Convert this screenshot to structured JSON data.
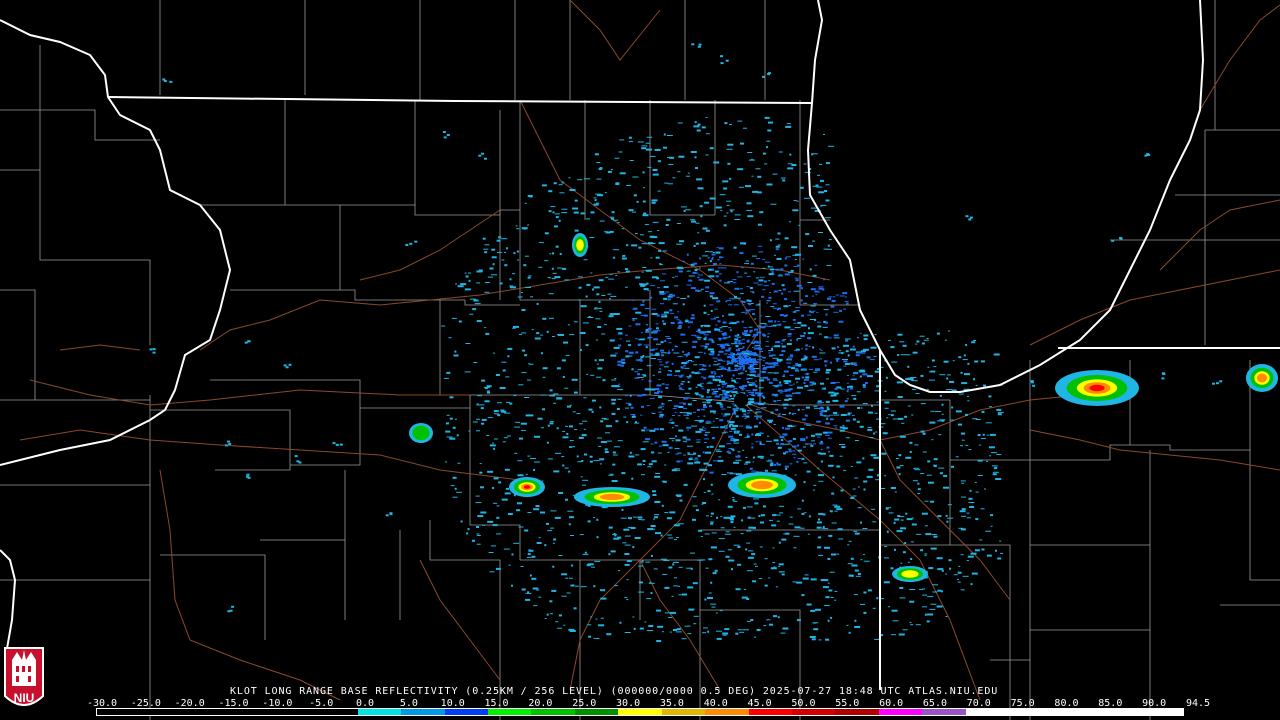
{
  "header": {
    "product_line": "KLOT LONG RANGE BASE REFLECTIVITY (0.25KM / 256 LEVEL) (000000/0000 0.5 DEG) 2025-07-27 18:48 UTC  ATLAS.NIU.EDU"
  },
  "logo": {
    "text": "NIU"
  },
  "legend": {
    "ticks": [
      "-30.0",
      "-25.0",
      "-20.0",
      "-15.0",
      "-10.0",
      "-5.0",
      "0.0",
      "5.0",
      "10.0",
      "15.0",
      "20.0",
      "25.0",
      "30.0",
      "35.0",
      "40.0",
      "45.0",
      "50.0",
      "55.0",
      "60.0",
      "65.0",
      "70.0",
      "75.0",
      "80.0",
      "85.0",
      "90.0",
      "94.5"
    ],
    "colors": [
      "#000000",
      "#000000",
      "#000000",
      "#000000",
      "#000000",
      "#000000",
      "#00e4e4",
      "#0098e8",
      "#0040f0",
      "#00f000",
      "#00c000",
      "#009000",
      "#ffff00",
      "#e0b800",
      "#ff8c00",
      "#ff0000",
      "#d40000",
      "#b00000",
      "#ff00ff",
      "#9955c8",
      "#ffffff",
      "#ffffff",
      "#ffffff",
      "#ffffff",
      "#ffffff"
    ]
  },
  "map_data": {
    "radar_site": "KLOT",
    "storm_cells": [
      {
        "name": "cell-west-central",
        "dbz": 55
      },
      {
        "name": "cell-south-central",
        "dbz": 50
      },
      {
        "name": "cell-southeast",
        "dbz": 50
      },
      {
        "name": "cell-northwest-indiana",
        "dbz": 55
      },
      {
        "name": "cell-far-east",
        "dbz": 50
      },
      {
        "name": "cell-lake-county",
        "dbz": 45
      },
      {
        "name": "cell-western-illinois",
        "dbz": 40
      },
      {
        "name": "cell-north-kane",
        "dbz": 45
      }
    ],
    "colors": {
      "state_border": "#ffffff",
      "county_border": "#9a9a9a",
      "highway": "#8b4a2a",
      "light_echo": "#1fb6e6",
      "medium_echo": "#1a6ef0"
    }
  }
}
